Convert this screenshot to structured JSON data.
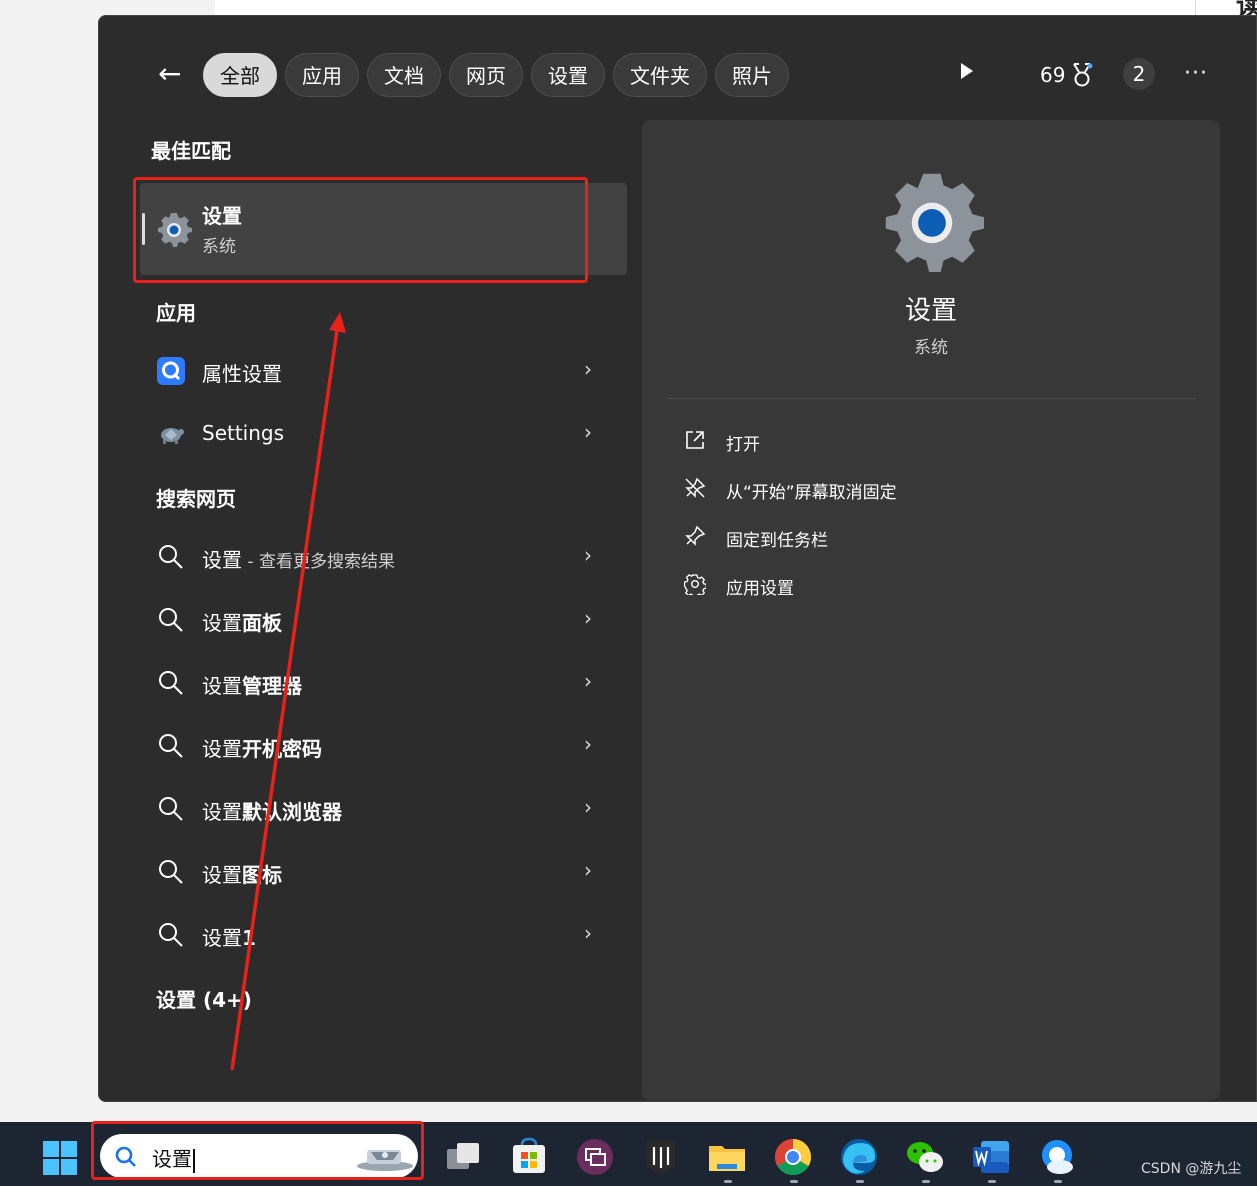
{
  "filters": {
    "back_label": "←",
    "tabs": [
      "全部",
      "应用",
      "文档",
      "网页",
      "设置",
      "文件夹",
      "照片"
    ],
    "active_tab": "全部",
    "points": "69",
    "badge_count": "2",
    "more_label": "···"
  },
  "results": {
    "best_match_heading": "最佳匹配",
    "best_match": {
      "title": "设置",
      "subtitle": "系统",
      "icon": "settings-gear-icon"
    },
    "apps_heading": "应用",
    "apps": [
      {
        "label": "属性设置",
        "icon": "app-q-icon"
      },
      {
        "label": "Settings",
        "icon": "turtle-app-icon"
      }
    ],
    "web_heading": "搜索网页",
    "web": [
      {
        "prefix": "设置",
        "suffix": " - 查看更多搜索结果"
      },
      {
        "prefix": "设置",
        "suffix": "面板"
      },
      {
        "prefix": "设置",
        "suffix": "管理器"
      },
      {
        "prefix": "设置",
        "suffix": "开机密码"
      },
      {
        "prefix": "设置",
        "suffix": "默认浏览器"
      },
      {
        "prefix": "设置",
        "suffix": "图标"
      },
      {
        "prefix": "设置",
        "suffix": "1"
      }
    ],
    "settings_heading": "设置 (4+)"
  },
  "detail": {
    "title": "设置",
    "subtitle": "系统",
    "actions": [
      {
        "label": "打开",
        "icon": "open-external-icon"
      },
      {
        "label": "从“开始”屏幕取消固定",
        "icon": "unpin-icon"
      },
      {
        "label": "固定到任务栏",
        "icon": "pin-icon"
      },
      {
        "label": "应用设置",
        "icon": "gear-icon"
      }
    ]
  },
  "taskbar": {
    "search_value": "设置",
    "apps": [
      "task-view",
      "microsoft-store",
      "remote-desktop",
      "epic-games",
      "file-explorer",
      "chrome",
      "edge",
      "wechat",
      "word",
      "qq-cloud"
    ]
  },
  "background": {
    "corner_text": "读"
  },
  "watermark": "CSDN @游九尘",
  "colors": {
    "accent_red": "#e8211b",
    "panel": "#2c2c2c",
    "pane": "#383838",
    "taskbar": "#1d2533"
  }
}
